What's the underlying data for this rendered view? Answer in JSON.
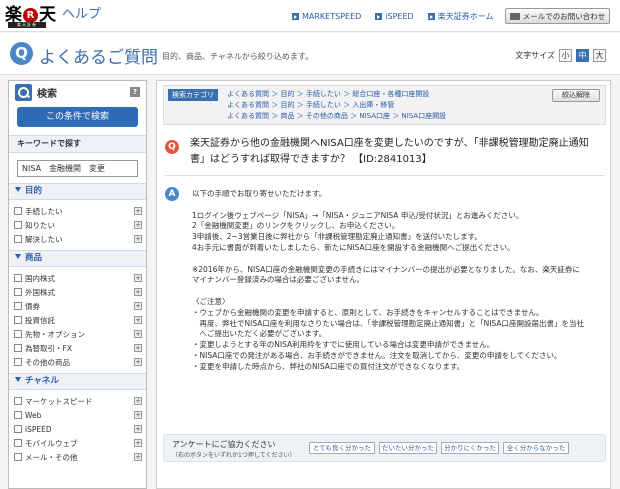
{
  "header": {
    "logo_kanji_1": "楽",
    "logo_r": "R",
    "logo_kanji_2": "天",
    "logo_sub": "楽天証券",
    "logo_help": "ヘルプ",
    "links": [
      "MARKETSPEED",
      "iSPEED",
      "楽天証券ホーム"
    ],
    "mail_button": "メールでのお問い合わせ"
  },
  "titlebar": {
    "icon": "Q",
    "title": "よくあるご質問",
    "subtitle": "目的、商品、チャネルから絞り込めます。",
    "font_size_label": "文字サイズ",
    "font_sizes": [
      "小",
      "中",
      "大"
    ],
    "font_size_selected": "中"
  },
  "sidebar": {
    "search_label": "検索",
    "help_mark": "?",
    "search_button": "この条件で検索",
    "keyword_heading": "キーワードで探す",
    "keyword_value": "NISA　金融機関　変更",
    "categories": [
      {
        "title": "目的",
        "items": [
          "手続したい",
          "知りたい",
          "解決したい"
        ]
      },
      {
        "title": "商品",
        "items": [
          "国内株式",
          "外国株式",
          "債券",
          "投資信託",
          "先物・オプション",
          "為替取引・FX",
          "その他の商品"
        ]
      },
      {
        "title": "チャネル",
        "items": [
          "マーケットスピード",
          "Web",
          "iSPEED",
          "モバイルウェブ",
          "メール・その他"
        ]
      }
    ]
  },
  "main": {
    "category_tag": "検索カテゴリ",
    "breadcrumbs": [
      "よくある質問 ＞ 目的 ＞ 手続したい ＞ 総合口座・各種口座開設",
      "よくある質問 ＞ 目的 ＞ 手続したい ＞ 入出庫・移管",
      "よくある質問 ＞ 商品 ＞ その他の商品 ＞ NISA口座 ＞ NISA口座開設"
    ],
    "reset_button": "絞込解除",
    "question_icon": "Q",
    "question_line1": "楽天証券から他の金融機関へNISA口座を変更したいのですが、「非課税管理勘定廃止通知",
    "question_line2": "書」はどうすれば取得できますか？ 【ID:2841013】",
    "answer_icon": "A",
    "answer_lines": [
      "以下の手順でお取り寄せいただけます。",
      "",
      "1ログイン後ウェブページ「NISA」→「NISA・ジュニアNISA 申込/受付状況」とお進みください。",
      "2「金融機関変更」のリンクをクリックし、お申込ください。",
      "3申請後、2~3営業日後に弊社から「非課税管理勘定廃止通知書」を送付いたします。",
      "4お手元に書面が到着いたしましたら、新たにNISA口座を開設する金融機関へご提出ください。",
      "",
      "※2016年から、NISA口座の金融機関変更の手続きにはマイナンバーの提出が必要となりました。なお、楽天証券に",
      "マイナンバー登録済みの場合は必要ございません。",
      "",
      "〈ご注意〉",
      "・ウェブから金融機関の変更を申請すると、原則として、お手続きをキャンセルすることはできません。",
      "　再度、弊社でNISA口座を利用なさりたい場合は、「非課税管理勘定廃止通知書」と「NISA口座開設届出書」を当社",
      "　へご提出いただく必要がございます。",
      "・変更しようとする年のNISA利用枠をすでに使用している場合は変更申請ができません。",
      "・NISA口座での発注がある場合、お手続きができません。注文を取消してから、変更の申請をしてください。",
      "・変更を申請した時点から、弊社のNISA口座での買付注文ができなくなります。"
    ],
    "survey_title": "アンケートにご協力ください",
    "survey_note": "（右のボタンをいずれか1つ押してください）",
    "survey_buttons": [
      "とても良く分かった",
      "だいたい分かった",
      "分かりにくかった",
      "全く分からなかった"
    ]
  }
}
